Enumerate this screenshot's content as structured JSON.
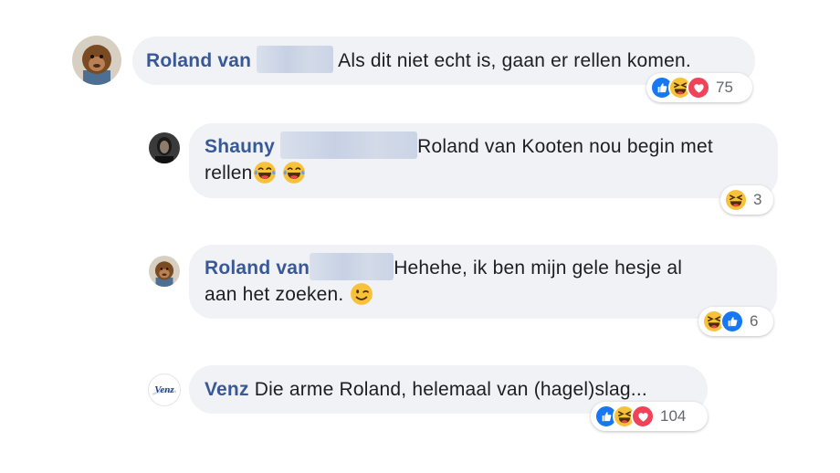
{
  "comments": [
    {
      "name": "Roland van",
      "text": "Als dit niet echt is, gaan er rellen komen.",
      "avatar": "orangutan-avatar",
      "reactions": [
        "like",
        "haha",
        "love"
      ],
      "reaction_count": "75"
    },
    {
      "name": "Shauny",
      "text_line1": "Roland van Kooten nou begin met",
      "text_line2": "rellen",
      "emojis": [
        "tears-of-joy-emoji",
        "tears-of-joy-emoji"
      ],
      "avatar": "person-avatar",
      "reactions": [
        "haha"
      ],
      "reaction_count": "3"
    },
    {
      "name": "Roland van",
      "text_line1": "Hehehe, ik ben mijn gele hesje al",
      "text_line2": "aan het zoeken.",
      "emojis": [
        "winking-emoji"
      ],
      "avatar": "orangutan-avatar",
      "reactions": [
        "haha",
        "like"
      ],
      "reaction_count": "6"
    },
    {
      "name": "Venz",
      "text": "Die arme Roland, helemaal van (hagel)slag...",
      "avatar": "venz-logo-avatar",
      "avatar_logo_text": "Venz",
      "reactions": [
        "like",
        "haha",
        "love"
      ],
      "reaction_count": "104"
    }
  ],
  "colors": {
    "name": "#385898",
    "bubble": "#f0f2f5",
    "like": "#1877f2",
    "haha": "#f7c23a",
    "love": "#f0435a"
  }
}
